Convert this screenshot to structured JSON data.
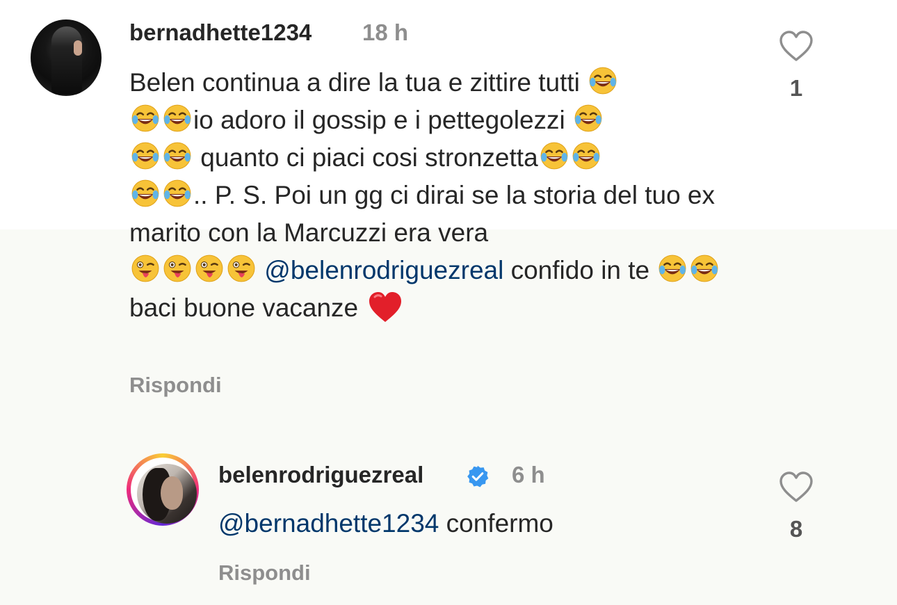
{
  "comments": [
    {
      "username": "bernadhette1234",
      "time": "18 h",
      "text_parts": [
        "Belen continua a dire la tua e zittire tutti ",
        "io adoro il gossip e i pettegolezzi ",
        " quanto ci piaci cosi stronzetta",
        ".. P. S. Poi un gg ci dirai se la storia del tuo ex marito con la Marcuzzi era vera ",
        "@belenrodriguezreal",
        "  confido in te ",
        " baci buone vacanze "
      ],
      "reply_label": "Rispondi",
      "like_count": "1"
    },
    {
      "username": "belenrodriguezreal",
      "verified": true,
      "time": "6 h",
      "mention": "@bernadhette1234",
      "text": " confermo",
      "reply_label": "Rispondi",
      "like_count": "8"
    }
  ],
  "icons": {
    "like": "heart-outline-icon",
    "verified": "verified-badge-icon",
    "laugh": "face-with-tears-of-joy-emoji",
    "tongue": "winking-face-with-tongue-emoji",
    "heart": "red-heart-emoji"
  },
  "colors": {
    "mention": "#00376b",
    "verified": "#3897f0",
    "muted": "#8e8e8e"
  }
}
